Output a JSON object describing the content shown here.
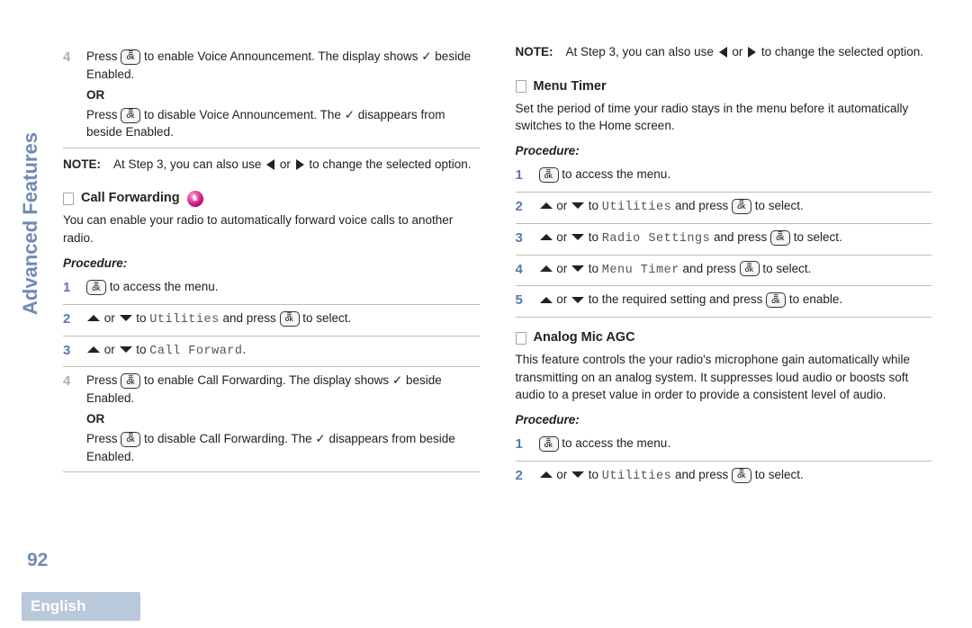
{
  "sidebar_label": "Advanced Features",
  "page_number": "92",
  "language_tab": "English",
  "labels": {
    "note": "NOTE:",
    "or": "OR",
    "procedure": "Procedure:"
  },
  "left": {
    "step4a": {
      "num": "4",
      "line1_pre": "Press ",
      "line1_post": " to enable Voice Announcement. The display shows ",
      "line1_end": " beside Enabled.",
      "line2_pre": "Press ",
      "line2_post": " to disable Voice Announcement. The ",
      "line2_end": " disappears from beside Enabled."
    },
    "note1_pre": "At Step 3, you can also use ",
    "note1_mid": " or ",
    "note1_post": " to change the selected option.",
    "cf_heading": "Call Forwarding",
    "cf_body": "You can enable your radio to automatically forward voice calls to another radio.",
    "cf_step1": {
      "num": "1",
      "post": " to access the menu."
    },
    "cf_step2": {
      "num": "2",
      "mid": " or ",
      "to": " to ",
      "menu": "Utilities",
      "press": " and press ",
      "end": " to select."
    },
    "cf_step3": {
      "num": "3",
      "mid": " or ",
      "to": " to ",
      "menu": "Call Forward",
      "end": "."
    },
    "cf_step4": {
      "num": "4",
      "line1_pre": "Press ",
      "line1_post": " to enable Call Forwarding. The display shows ",
      "line1_end": " beside Enabled.",
      "line2_pre": "Press ",
      "line2_post": " to disable Call Forwarding. The ",
      "line2_end": " disappears from beside Enabled."
    }
  },
  "right": {
    "note2_pre": "At Step 3, you can also use ",
    "note2_mid": " or ",
    "note2_post": " to change the selected option.",
    "mt_heading": "Menu Timer",
    "mt_body": "Set the period of time your radio stays in the menu before it automatically switches to the Home screen.",
    "mt_step1": {
      "num": "1",
      "post": " to access the menu."
    },
    "mt_step2": {
      "num": "2",
      "mid": " or ",
      "to": " to ",
      "menu": "Utilities",
      "press": " and press ",
      "end": " to select."
    },
    "mt_step3": {
      "num": "3",
      "mid": " or ",
      "to": " to ",
      "menu": "Radio Settings",
      "press": " and press ",
      "end": " to select."
    },
    "mt_step4": {
      "num": "4",
      "mid": " or ",
      "to": " to ",
      "menu": "Menu Timer",
      "press": " and press ",
      "end": " to select."
    },
    "mt_step5": {
      "num": "5",
      "mid": " or ",
      "to": " to the required setting and press ",
      "end": " to enable."
    },
    "agc_heading": "Analog Mic AGC",
    "agc_body": "This feature controls the your radio's microphone gain automatically while transmitting on an analog system. It suppresses loud audio or boosts soft audio to a preset value in order to provide a consistent level of audio.",
    "agc_step1": {
      "num": "1",
      "post": " to access the menu."
    },
    "agc_step2": {
      "num": "2",
      "mid": " or ",
      "to": " to ",
      "menu": "Utilities",
      "press": " and press ",
      "end": " to select."
    }
  }
}
